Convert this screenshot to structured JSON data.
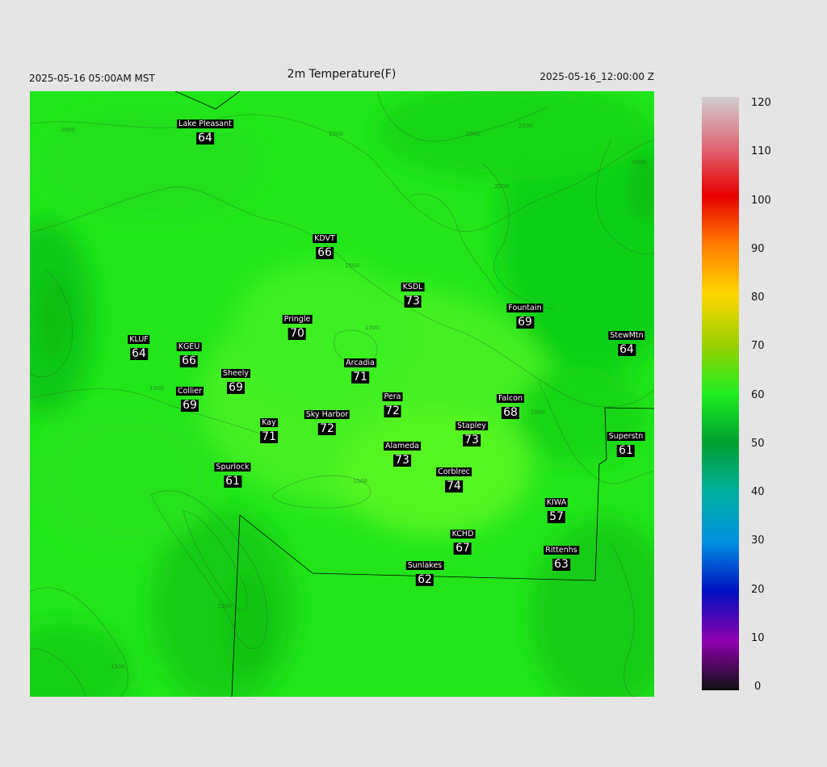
{
  "header": {
    "title": "2m Temperature(F)",
    "valid_local": "2025-05-16 05:00AM MST",
    "valid_utc": "2025-05-16_12:00:00 Z"
  },
  "contour_labels": [
    "2000",
    "2000",
    "2000",
    "2500",
    "2500",
    "3000",
    "1500",
    "1500",
    "1000",
    "1500",
    "1500",
    "1500",
    "1500"
  ],
  "stations": [
    {
      "name": "Lake Pleasant",
      "temp": "64"
    },
    {
      "name": "KDVT",
      "temp": "66"
    },
    {
      "name": "KSDL",
      "temp": "73"
    },
    {
      "name": "Pringle",
      "temp": "70"
    },
    {
      "name": "Fountain",
      "temp": "69"
    },
    {
      "name": "KLUF",
      "temp": "64"
    },
    {
      "name": "KGEU",
      "temp": "66"
    },
    {
      "name": "StewMtn",
      "temp": "64"
    },
    {
      "name": "Arcadia",
      "temp": "71"
    },
    {
      "name": "Sheely",
      "temp": "69"
    },
    {
      "name": "Collier",
      "temp": "69"
    },
    {
      "name": "Pera",
      "temp": "72"
    },
    {
      "name": "Falcon",
      "temp": "68"
    },
    {
      "name": "Kay",
      "temp": "71"
    },
    {
      "name": "Sky Harbor",
      "temp": "72"
    },
    {
      "name": "Stapley",
      "temp": "73"
    },
    {
      "name": "Superstn",
      "temp": "61"
    },
    {
      "name": "Alameda",
      "temp": "73"
    },
    {
      "name": "Spurlock",
      "temp": "61"
    },
    {
      "name": "Corblrec",
      "temp": "74"
    },
    {
      "name": "KIWA",
      "temp": "57"
    },
    {
      "name": "KCHD",
      "temp": "67"
    },
    {
      "name": "Rittenhs",
      "temp": "63"
    },
    {
      "name": "Sunlakes",
      "temp": "62"
    }
  ],
  "colorbar": {
    "ticks": [
      "120",
      "110",
      "100",
      "90",
      "80",
      "70",
      "60",
      "50",
      "40",
      "30",
      "20",
      "10",
      "0"
    ],
    "colors": [
      "#cfcfcf",
      "#e06a78",
      "#e80000",
      "#ff7f00",
      "#ffd700",
      "#9ad000",
      "#20ee20",
      "#00a030",
      "#00b0a0",
      "#0090e0",
      "#0010c0",
      "#9000b0",
      "#101010"
    ]
  }
}
